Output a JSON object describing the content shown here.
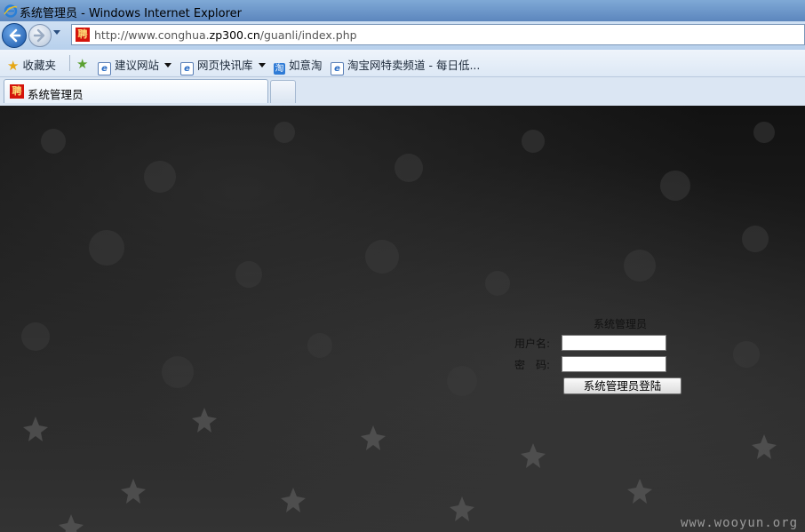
{
  "window": {
    "title": "系统管理员 - Windows Internet Explorer"
  },
  "address_bar": {
    "url_prefix": "http://www.conghua.",
    "url_host": "zp300.cn",
    "url_path": "/guanli/index.php",
    "site_icon_char": "聘"
  },
  "favorites": {
    "label": "收藏夹",
    "items": [
      {
        "label": "建议网站",
        "icon": "ie-page-icon",
        "has_dropdown": true
      },
      {
        "label": "网页快讯库",
        "icon": "ie-page-icon",
        "has_dropdown": true
      },
      {
        "label": "如意淘",
        "icon": "taobao-icon",
        "has_dropdown": false
      },
      {
        "label": "淘宝网特卖频道 - 每日低...",
        "icon": "ie-page-icon",
        "has_dropdown": false
      }
    ]
  },
  "tab": {
    "label": "系统管理员"
  },
  "login": {
    "title": "系统管理员",
    "username_label": "用户名:",
    "password_label": "密　码:",
    "username_value": "",
    "password_value": "",
    "submit_label": "系统管理员登陆"
  },
  "watermark": "www.wooyun.org",
  "colors": {
    "titlebar": "#6b95c8",
    "content_bg": "#1c1c1c"
  }
}
